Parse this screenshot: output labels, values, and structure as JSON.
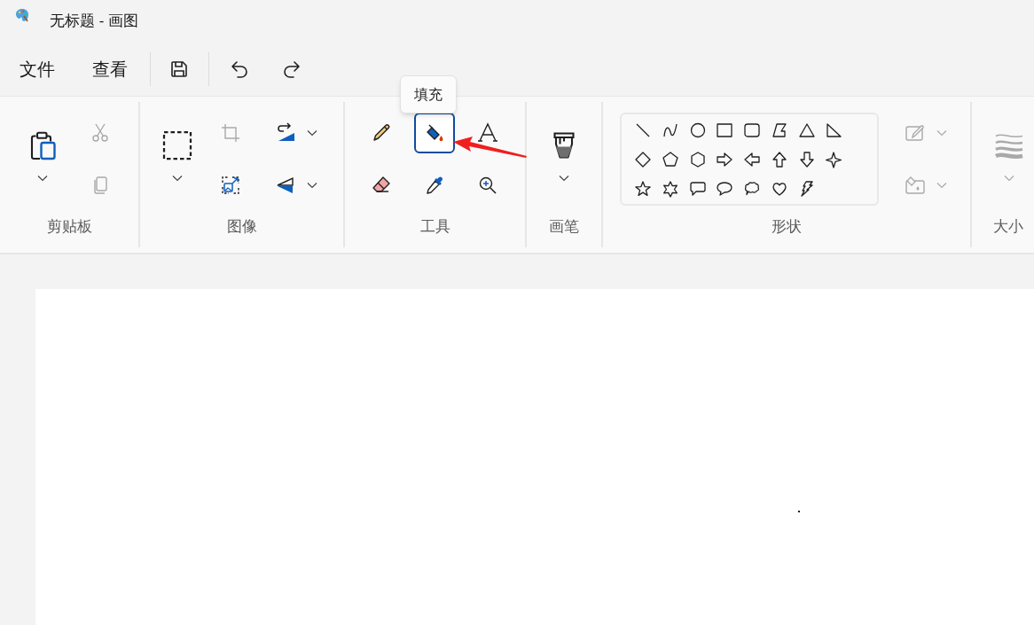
{
  "window": {
    "title": "无标题 - 画图"
  },
  "menu": [
    {
      "label": "文件"
    },
    {
      "label": "查看"
    }
  ],
  "quick_actions": [
    {
      "kind": "save"
    },
    {
      "kind": "undo"
    },
    {
      "kind": "redo"
    }
  ],
  "ribbon": {
    "groups": [
      {
        "kind": "clipboard",
        "label": "剪贴板",
        "tools": [
          {
            "kind": "paste",
            "disabled": false
          },
          {
            "kind": "cut",
            "disabled": true
          },
          {
            "kind": "copy",
            "disabled": true
          }
        ]
      },
      {
        "kind": "image",
        "label": "图像",
        "tools": [
          {
            "kind": "select",
            "disabled": false
          },
          {
            "kind": "crop",
            "disabled": true
          },
          {
            "kind": "resize",
            "disabled": false
          },
          {
            "kind": "rotate",
            "disabled": false
          },
          {
            "kind": "flip",
            "disabled": false
          }
        ]
      },
      {
        "kind": "tools",
        "label": "工具",
        "tools": [
          {
            "kind": "pencil",
            "disabled": false,
            "selected": false
          },
          {
            "kind": "fill",
            "disabled": false,
            "selected": true
          },
          {
            "kind": "text",
            "disabled": false,
            "selected": false
          },
          {
            "kind": "eraser",
            "disabled": false,
            "selected": false
          },
          {
            "kind": "picker",
            "disabled": false,
            "selected": false
          },
          {
            "kind": "magnifier",
            "disabled": false,
            "selected": false
          }
        ]
      },
      {
        "kind": "brushes",
        "label": "画笔",
        "tools": [
          {
            "kind": "brush",
            "disabled": false
          }
        ]
      },
      {
        "kind": "shapes",
        "label": "形状",
        "tools": [
          {
            "kind": "outline",
            "disabled": true
          },
          {
            "kind": "shape_fill",
            "disabled": true
          }
        ]
      },
      {
        "kind": "size",
        "label": "大小",
        "tools": [
          {
            "kind": "size",
            "disabled": true
          }
        ]
      }
    ]
  },
  "tooltip": {
    "text": "填充"
  }
}
